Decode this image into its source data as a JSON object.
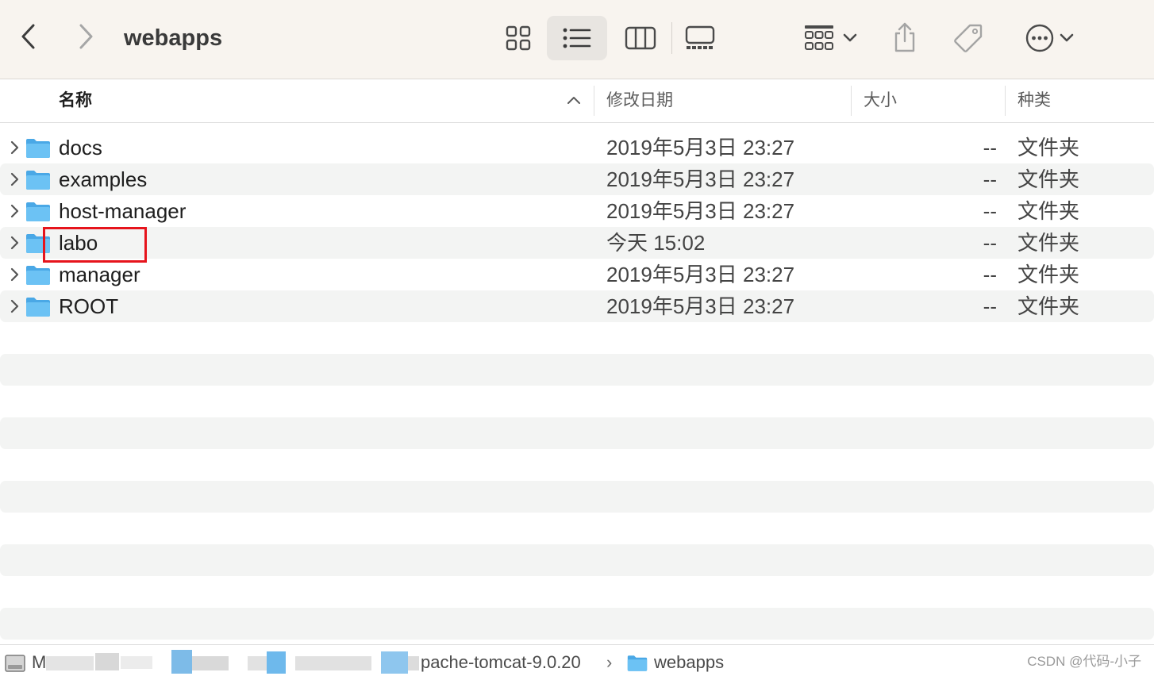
{
  "window": {
    "title": "webapps"
  },
  "toolbar": {
    "back_icon": "chevron-left-icon",
    "forward_icon": "chevron-right-icon",
    "view_modes": [
      "icon-view",
      "list-view",
      "column-view",
      "gallery-view"
    ],
    "active_view": "list-view",
    "group_icon": "group-icon",
    "share_icon": "share-icon",
    "tag_icon": "tag-icon",
    "more_icon": "more-icon"
  },
  "columns": {
    "name": "名称",
    "date": "修改日期",
    "size": "大小",
    "kind": "种类",
    "sort": "ascending"
  },
  "files": [
    {
      "name": "docs",
      "date": "2019年5月3日 23:27",
      "size": "--",
      "kind": "文件夹"
    },
    {
      "name": "examples",
      "date": "2019年5月3日 23:27",
      "size": "--",
      "kind": "文件夹"
    },
    {
      "name": "host-manager",
      "date": "2019年5月3日 23:27",
      "size": "--",
      "kind": "文件夹"
    },
    {
      "name": "labo",
      "date": "今天 15:02",
      "size": "--",
      "kind": "文件夹"
    },
    {
      "name": "manager",
      "date": "2019年5月3日 23:27",
      "size": "--",
      "kind": "文件夹"
    },
    {
      "name": "ROOT",
      "date": "2019年5月3日 23:27",
      "size": "--",
      "kind": "文件夹"
    }
  ],
  "pathbar": {
    "first": "M",
    "parent": "pache-tomcat-9.0.20",
    "separator": "›",
    "current": "webapps"
  },
  "watermark": "CSDN @代码-小子",
  "colors": {
    "toolbar_bg": "#f8f4ef",
    "stripe": "#f3f4f3",
    "folder": "#5ab3ec",
    "highlight": "#e6141c"
  }
}
